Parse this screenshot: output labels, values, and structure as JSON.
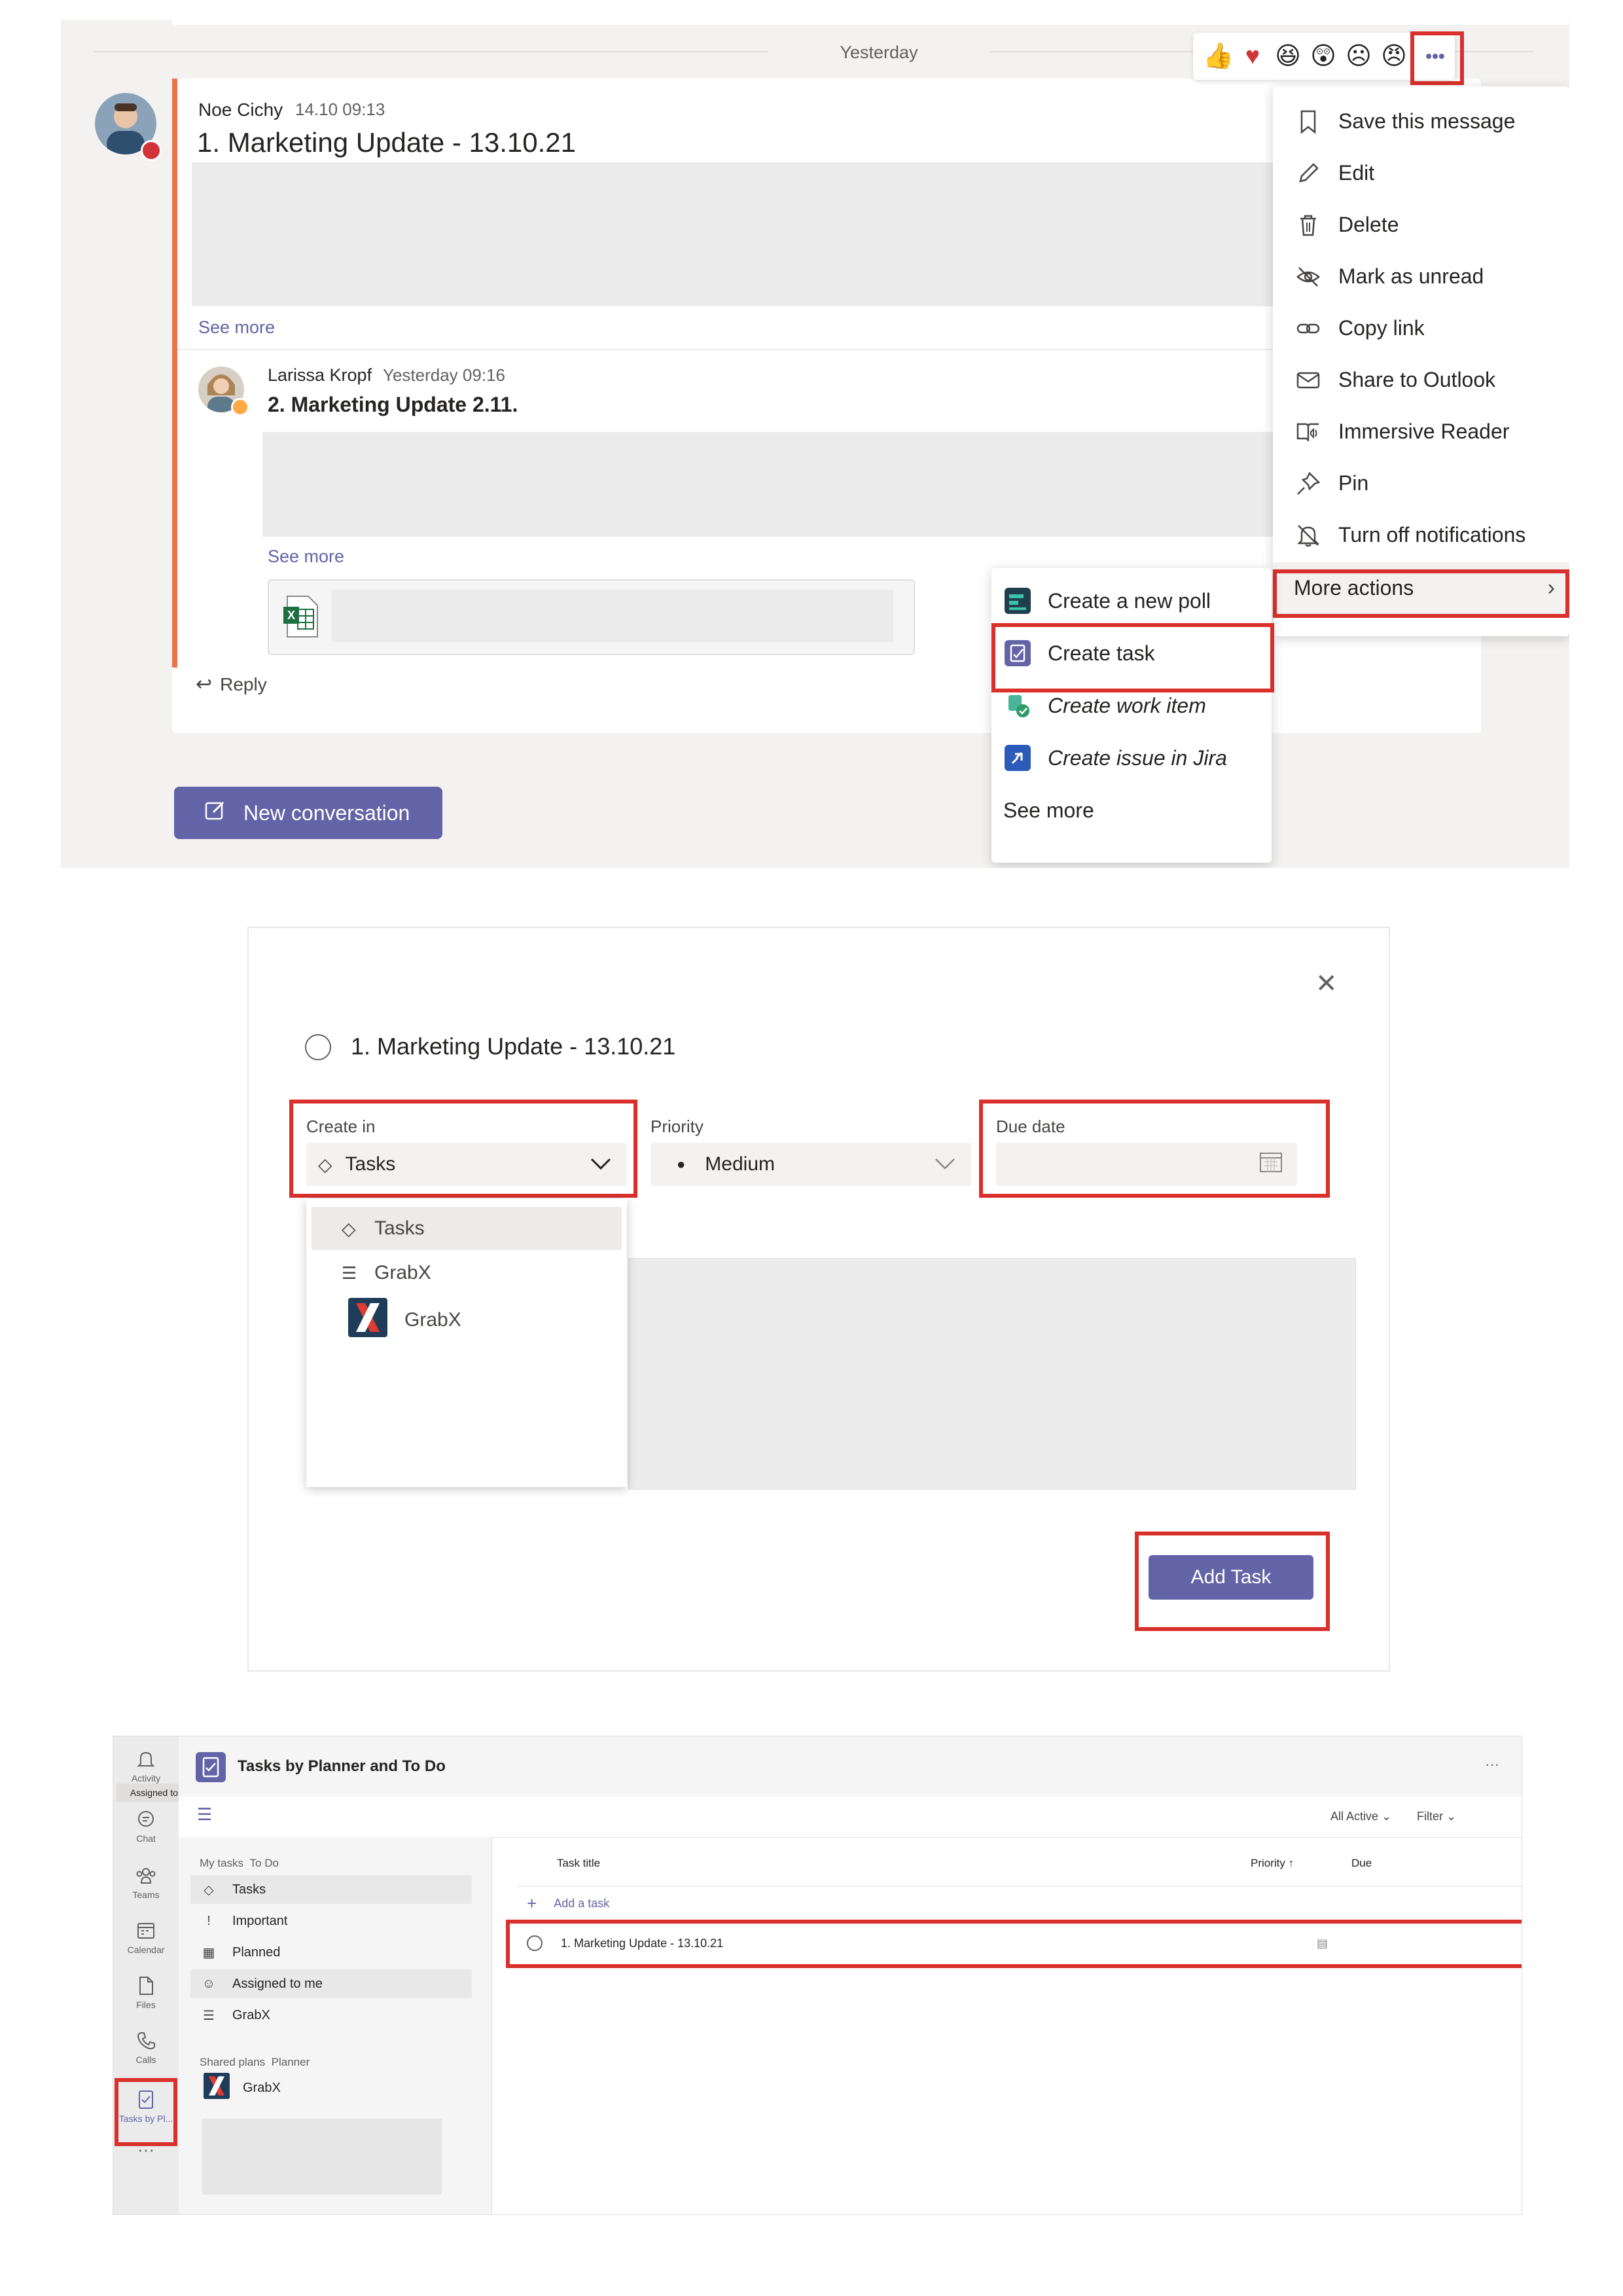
{
  "colors": {
    "accent": "#6264a7",
    "highlight": "#d9302c",
    "excel": "#1d6f42",
    "jira": "#2d5bb9"
  },
  "channel": {
    "date_divider": "Yesterday",
    "reactions": [
      "thumbs-up",
      "heart",
      "laugh",
      "surprised",
      "sad",
      "angry"
    ],
    "more_options_glyph": "•••",
    "message1": {
      "author": "Noe Cichy",
      "time": "14.10 09:13",
      "title": "1. Marketing Update - 13.10.21",
      "see_more": "See more"
    },
    "message2": {
      "author": "Larissa Kropf",
      "time": "Yesterday 09:16",
      "title": "2. Marketing Update 2.11.",
      "see_more": "See more",
      "attachment_icon": "excel-file-icon"
    },
    "reply": "Reply",
    "new_conversation": "New conversation"
  },
  "context_menu": {
    "items": [
      {
        "label": "Save this message",
        "icon": "bookmark-icon"
      },
      {
        "label": "Edit",
        "icon": "pencil-icon"
      },
      {
        "label": "Delete",
        "icon": "trash-icon"
      },
      {
        "label": "Mark as unread",
        "icon": "unread-icon"
      },
      {
        "label": "Copy link",
        "icon": "link-icon"
      },
      {
        "label": "Share to Outlook",
        "icon": "mail-icon"
      },
      {
        "label": "Immersive Reader",
        "icon": "immersive-reader-icon"
      },
      {
        "label": "Pin",
        "icon": "pin-icon"
      },
      {
        "label": "Turn off notifications",
        "icon": "bell-off-icon"
      }
    ],
    "more_actions": "More actions"
  },
  "submenu": {
    "items": [
      {
        "label": "Create a new poll",
        "icon": "poll-app-icon"
      },
      {
        "label": "Create task",
        "icon": "tasks-app-icon"
      },
      {
        "label": "Create work item",
        "icon": "work-item-app-icon"
      },
      {
        "label": "Create issue in Jira",
        "icon": "jira-app-icon"
      }
    ],
    "see_more": "See more"
  },
  "dialog": {
    "task_title": "1. Marketing Update - 13.10.21",
    "create_in_label": "Create in",
    "create_in_value": "Tasks",
    "priority_label": "Priority",
    "priority_value": "Medium",
    "due_date_label": "Due date",
    "dropdown_options": [
      "Tasks",
      "GrabX",
      "GrabX"
    ],
    "add_task_button": "Add Task"
  },
  "tasks_app": {
    "app_title": "Tasks by Planner and To Do",
    "header_more": "···",
    "rail": [
      {
        "label": "Activity",
        "icon": "bell-icon"
      },
      {
        "label": "Chat",
        "icon": "chat-icon"
      },
      {
        "label": "Teams",
        "icon": "teams-icon"
      },
      {
        "label": "Calendar",
        "icon": "calendar-icon"
      },
      {
        "label": "Files",
        "icon": "files-icon"
      },
      {
        "label": "Calls",
        "icon": "phone-icon"
      },
      {
        "label": "Tasks by Pl...",
        "icon": "tasks-icon"
      }
    ],
    "rail_tooltip": "Assigned to me",
    "rail_more": "···",
    "filter_all_active": "All Active",
    "filter_label": "Filter",
    "my_tasks_heading": "My tasks",
    "my_tasks_sub": "To Do",
    "nav": [
      {
        "label": "Tasks",
        "icon": "◇"
      },
      {
        "label": "Important",
        "icon": "!"
      },
      {
        "label": "Planned",
        "icon": "▦"
      },
      {
        "label": "Assigned to me",
        "icon": "☺"
      },
      {
        "label": "GrabX",
        "icon": "☰"
      }
    ],
    "shared_plans_heading": "Shared plans",
    "shared_plans_sub": "Planner",
    "shared_plan": "GrabX",
    "columns": {
      "title": "Task title",
      "priority": "Priority ↑",
      "due": "Due"
    },
    "add_task": "Add a task",
    "task_row": "1. Marketing Update - 13.10.21",
    "row_more": "···"
  }
}
